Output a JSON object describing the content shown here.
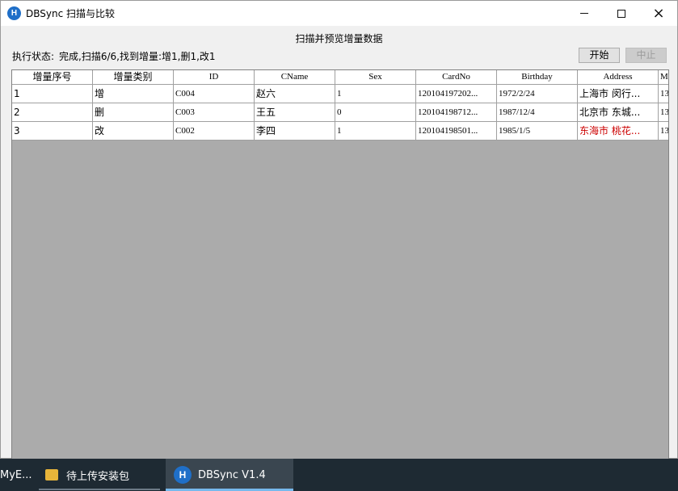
{
  "window": {
    "title": "DBSync 扫描与比较",
    "icon": "dbsync-logo-icon",
    "controls": {
      "minimize": "minimize-icon",
      "maximize": "maximize-icon",
      "close": "×"
    }
  },
  "heading": "扫描并预览增量数据",
  "status": {
    "label": "执行状态:",
    "text": "完成,扫描6/6,找到增量:增1,删1,改1"
  },
  "buttons": {
    "start": "开始",
    "stop": "中止"
  },
  "table": {
    "columns": [
      "增量序号",
      "增量类别",
      "ID",
      "CName",
      "Sex",
      "CardNo",
      "Birthday",
      "Address",
      "M"
    ],
    "rows": [
      [
        "1",
        "增",
        "C004",
        "赵六",
        "1",
        "120104197202...",
        "1972/2/24",
        "上海市 闵行...",
        "13"
      ],
      [
        "2",
        "删",
        "C003",
        "王五",
        "0",
        "120104198712...",
        "1987/12/4",
        "北京市 东城...",
        "13"
      ],
      [
        "3",
        "改",
        "C002",
        "李四",
        "1",
        "120104198501...",
        "1985/1/5",
        "东海市 桃花...",
        "13"
      ]
    ],
    "highlight_color": "#cc0000"
  },
  "taskbar": {
    "items": [
      "MyE...",
      "待上传安装包",
      "DBSync V1.4"
    ]
  }
}
